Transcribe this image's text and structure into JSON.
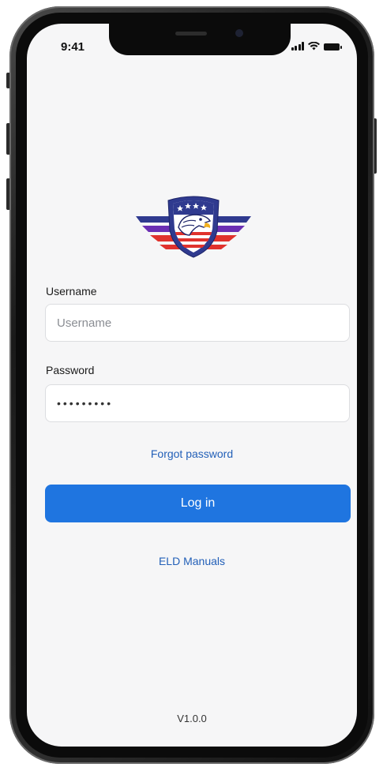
{
  "status_bar": {
    "time": "9:41"
  },
  "brand": {
    "logo_icon": "eagle-shield-logo",
    "colors": {
      "blue": "#2f3a8f",
      "purple": "#6b2fb3",
      "red": "#e0322d",
      "white": "#ffffff"
    }
  },
  "login_form": {
    "username_label": "Username",
    "username_placeholder": "Username",
    "username_value": "",
    "password_label": "Password",
    "password_value": "•••••••••",
    "forgot_password": "Forgot password",
    "login_button": "Log in",
    "eld_manuals": "ELD Manuals"
  },
  "footer": {
    "version": "V1.0.0"
  },
  "theme": {
    "primary": "#1f75e0",
    "link": "#2360b8",
    "background": "#f6f6f7"
  }
}
